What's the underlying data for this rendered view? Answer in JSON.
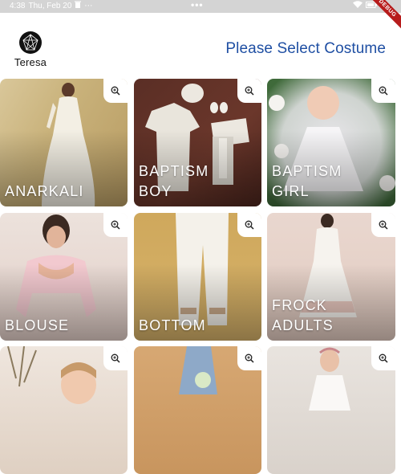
{
  "status_bar": {
    "time": "4:38",
    "date": "Thu, Feb 20",
    "center_dots": "•••",
    "debug_label": "DEBUG"
  },
  "header": {
    "brand_name": "Teresa",
    "title": "Please Select Costume",
    "title_color": "#1f4fa3"
  },
  "costumes": [
    {
      "label": "ANARKALI"
    },
    {
      "label": "BAPTISM\nBOY"
    },
    {
      "label": "BAPTISM\nGIRL"
    },
    {
      "label": "BLOUSE"
    },
    {
      "label": "BOTTOM"
    },
    {
      "label": "FROCK\nADULTS"
    },
    {
      "label": ""
    },
    {
      "label": ""
    },
    {
      "label": ""
    }
  ]
}
